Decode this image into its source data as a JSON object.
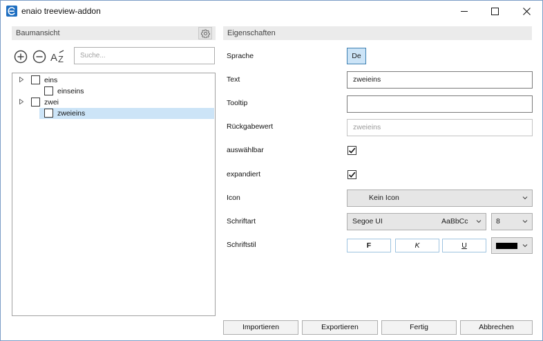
{
  "window": {
    "title": "enaio treeview-addon"
  },
  "left": {
    "header": "Baumansicht",
    "search_placeholder": "Suche...",
    "tree": [
      {
        "label": "eins"
      },
      {
        "label": "einseins"
      },
      {
        "label": "zwei"
      },
      {
        "label": "zweieins"
      }
    ]
  },
  "right": {
    "header": "Eigenschaften",
    "labels": {
      "sprache": "Sprache",
      "text": "Text",
      "tooltip": "Tooltip",
      "rueckgabe": "Rückgabewert",
      "auswaehlbar": "auswählbar",
      "expandiert": "expandiert",
      "icon": "Icon",
      "schriftart": "Schriftart",
      "schriftstil": "Schriftstil"
    },
    "sprache_button": "De",
    "text_value": "zweieins",
    "tooltip_value": "",
    "rueckgabe_placeholder": "zweieins",
    "auswaehlbar_checked": true,
    "expandiert_checked": true,
    "icon_value": "Kein Icon",
    "font_name": "Segoe UI",
    "font_preview": "AaBbCc",
    "font_size": "8",
    "style_bold": "F",
    "style_italic": "K",
    "style_underline": "U",
    "font_color": "#000000"
  },
  "buttons": {
    "import": "Importieren",
    "export": "Exportieren",
    "done": "Fertig",
    "cancel": "Abbrechen"
  }
}
